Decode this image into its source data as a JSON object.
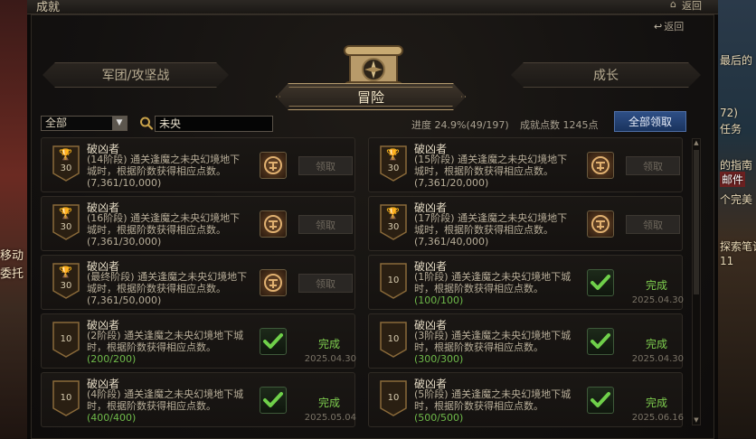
{
  "window": {
    "title": "成就",
    "back_top": "返回"
  },
  "background": {
    "left_fragments": [
      "移动",
      "委托"
    ],
    "right_fragments": [
      "最后的",
      "72)",
      "任务",
      "的指南",
      "邮件",
      "个完美",
      "探索笔记",
      "11"
    ]
  },
  "panel": {
    "back_label": "返回",
    "tabs": {
      "left": "军团/攻坚战",
      "active": "冒险",
      "right": "成长"
    }
  },
  "filter": {
    "selected": "全部"
  },
  "search": {
    "value": "未央"
  },
  "stats": {
    "progress": "进度 24.9%(49/197)",
    "points": "成就点数 1245点"
  },
  "claim_all_label": "全部领取",
  "achievements": [
    {
      "medal": "30",
      "trophy": true,
      "title": "破凶者",
      "desc": "(14阶段) 通关逢魔之未央幻境地下城时，根据阶数获得相应点数。",
      "progress": "(7,361/10,000)",
      "done": false,
      "claim_label": "领取"
    },
    {
      "medal": "30",
      "trophy": true,
      "title": "破凶者",
      "desc": "(15阶段) 通关逢魔之未央幻境地下城时，根据阶数获得相应点数。",
      "progress": "(7,361/20,000)",
      "done": false,
      "claim_label": "领取"
    },
    {
      "medal": "30",
      "trophy": true,
      "title": "破凶者",
      "desc": "(16阶段) 通关逢魔之未央幻境地下城时，根据阶数获得相应点数。",
      "progress": "(7,361/30,000)",
      "done": false,
      "claim_label": "领取"
    },
    {
      "medal": "30",
      "trophy": true,
      "title": "破凶者",
      "desc": "(17阶段) 通关逢魔之未央幻境地下城时，根据阶数获得相应点数。",
      "progress": "(7,361/40,000)",
      "done": false,
      "claim_label": "领取"
    },
    {
      "medal": "30",
      "trophy": true,
      "title": "破凶者",
      "desc": "(最终阶段) 通关逢魔之未央幻境地下城时，根据阶数获得相应点数。",
      "progress": "(7,361/50,000)",
      "done": false,
      "claim_label": "领取"
    },
    {
      "medal": "10",
      "trophy": false,
      "title": "破凶者",
      "desc": "(1阶段) 通关逢魔之未央幻境地下城时，根据阶数获得相应点数。",
      "progress": "(100/100)",
      "done": true,
      "status": "完成",
      "date": "2025.04.30"
    },
    {
      "medal": "10",
      "trophy": false,
      "title": "破凶者",
      "desc": "(2阶段) 通关逢魔之未央幻境地下城时，根据阶数获得相应点数。",
      "progress": "(200/200)",
      "done": true,
      "status": "完成",
      "date": "2025.04.30"
    },
    {
      "medal": "10",
      "trophy": false,
      "title": "破凶者",
      "desc": "(3阶段) 通关逢魔之未央幻境地下城时，根据阶数获得相应点数。",
      "progress": "(300/300)",
      "done": true,
      "status": "完成",
      "date": "2025.04.30"
    },
    {
      "medal": "10",
      "trophy": false,
      "title": "破凶者",
      "desc": "(4阶段) 通关逢魔之未央幻境地下城时，根据阶数获得相应点数。",
      "progress": "(400/400)",
      "done": true,
      "status": "完成",
      "date": "2025.05.04"
    },
    {
      "medal": "10",
      "trophy": false,
      "title": "破凶者",
      "desc": "(5阶段) 通关逢魔之未央幻境地下城时，根据阶数获得相应点数。",
      "progress": "(500/500)",
      "done": true,
      "status": "完成",
      "date": "2025.06.16"
    }
  ]
}
